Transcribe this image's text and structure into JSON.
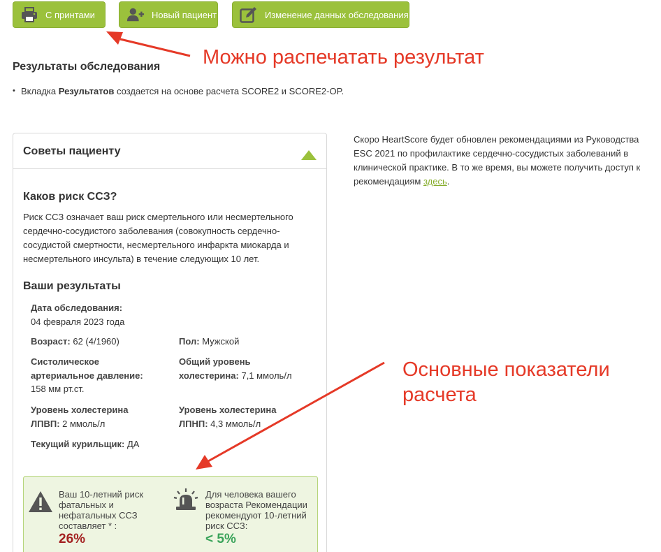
{
  "toolbar": {
    "print_label": "С принтами",
    "new_patient_label": "Новый пациент",
    "edit_exam_label": "Изменение данных обследования"
  },
  "page": {
    "title": "Результаты обследования",
    "intro_prefix": "Вкладка ",
    "intro_bold": "Результатов",
    "intro_suffix": " создается на основе расчета SCORE2 и SCORE2-OP."
  },
  "annotations": {
    "print": "Можно распечатать результат",
    "main_indicators": "Основные показатели расчета"
  },
  "advice": {
    "title": "Советы пациенту",
    "question_title": "Каков риск ССЗ?",
    "question_text": "Риск ССЗ означает ваш риск смертельного или несмертельного сердечно-сосудистого заболевания (совокупность сердечно-сосудистой смертности, несмертельного инфаркта миокарда и несмертельного инсульта) в течение следующих 10 лет.",
    "results_title": "Ваши результаты"
  },
  "results": {
    "exam_date_label": "Дата обследования:",
    "exam_date_value": "04 февраля 2023 года",
    "age_label": "Возраст:",
    "age_value": "62 (4/1960)",
    "sex_label": "Пол:",
    "sex_value": "Мужской",
    "sbp_label_1": "Систолическое",
    "sbp_label_2": "артериальное давление:",
    "sbp_value": "158 мм рт.ст.",
    "chol_label_1": "Общий уровень",
    "chol_label_2": "холестерина:",
    "chol_value": "7,1 ммоль/л",
    "hdl_label_1": "Уровень холестерина",
    "hdl_label_2": "ЛПВП:",
    "hdl_value": "2 ммоль/л",
    "ldl_label_1": "Уровень холестерина",
    "ldl_label_2": "ЛПНП:",
    "ldl_value": "4,3 ммоль/л",
    "smoker_label": "Текущий курильщик:",
    "smoker_value": "ДА"
  },
  "risk": {
    "your_risk_line1": "Ваш 10-летний риск",
    "your_risk_line2": "фатальных и",
    "your_risk_line3": "нефатальных ССЗ",
    "your_risk_line4": "составляет * :",
    "your_risk_value": "26%",
    "target_line1": "Для человека вашего",
    "target_line2": "возраста Рекомендации",
    "target_line3": "рекомендуют 10-летний",
    "target_line4": "риск ССЗ:",
    "target_value": "< 5%"
  },
  "side": {
    "text": "Скоро HeartScore будет обновлен рекомендациями из Руководства ESC 2021 по профилактике сердечно-сосудистых заболеваний в клинической практике. В то же время, вы можете получить доступ к рекомендациям ",
    "link": "здесь",
    "tail": "."
  },
  "colors": {
    "accent_green": "#9bc13c",
    "annotation_red": "#e53927",
    "risk_value_red": "#a32121",
    "target_value_green": "#3aa35a",
    "link_green": "#86ad2c"
  },
  "icons": [
    "printer-icon",
    "add-user-icon",
    "edit-icon",
    "chevron-up-icon",
    "warning-icon",
    "alarm-icon"
  ]
}
